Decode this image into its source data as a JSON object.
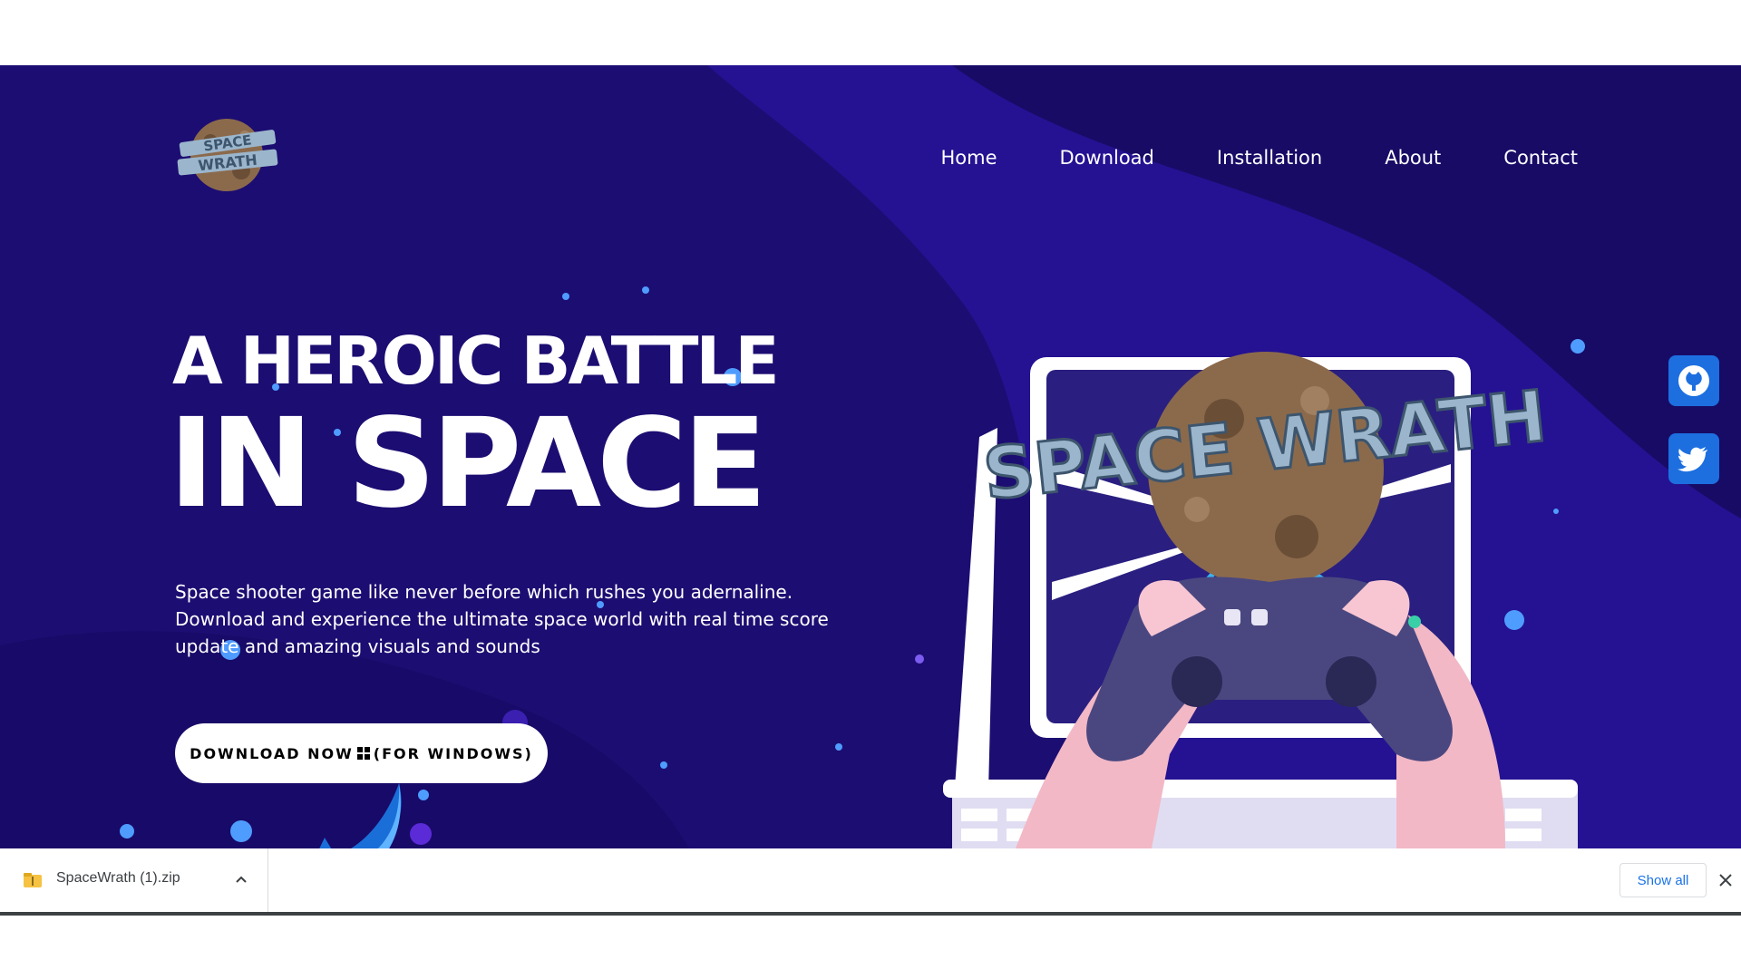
{
  "site": {
    "logo_text": "SPACE WRATH",
    "nav": [
      {
        "label": "Home"
      },
      {
        "label": "Download"
      },
      {
        "label": "Installation"
      },
      {
        "label": "About"
      },
      {
        "label": "Contact"
      }
    ]
  },
  "hero": {
    "title_line1": "A HEROIC BATTLE",
    "title_line2": "IN SPACE",
    "description_lines": [
      "Space shooter game like never before which rushes you adernaline.",
      "Download and experience the ultimate space world with real time score",
      "update and amazing visuals and sounds"
    ],
    "cta_prefix": "DOWNLOAD NOW",
    "cta_suffix": "(FOR WINDOWS)",
    "illustration_text": "SPACE WRATH"
  },
  "social": [
    {
      "name": "github",
      "icon": "github-icon"
    },
    {
      "name": "twitter",
      "icon": "twitter-icon"
    }
  ],
  "download_bar": {
    "filename": "SpaceWrath (1).zip",
    "show_all_label": "Show all",
    "close_glyph": "✕"
  },
  "colors": {
    "hero_bg": "#1c0d72",
    "hero_bg_light": "#2a1a9a",
    "accent_blue": "#1d6fe0",
    "link_blue": "#1a73e8"
  }
}
